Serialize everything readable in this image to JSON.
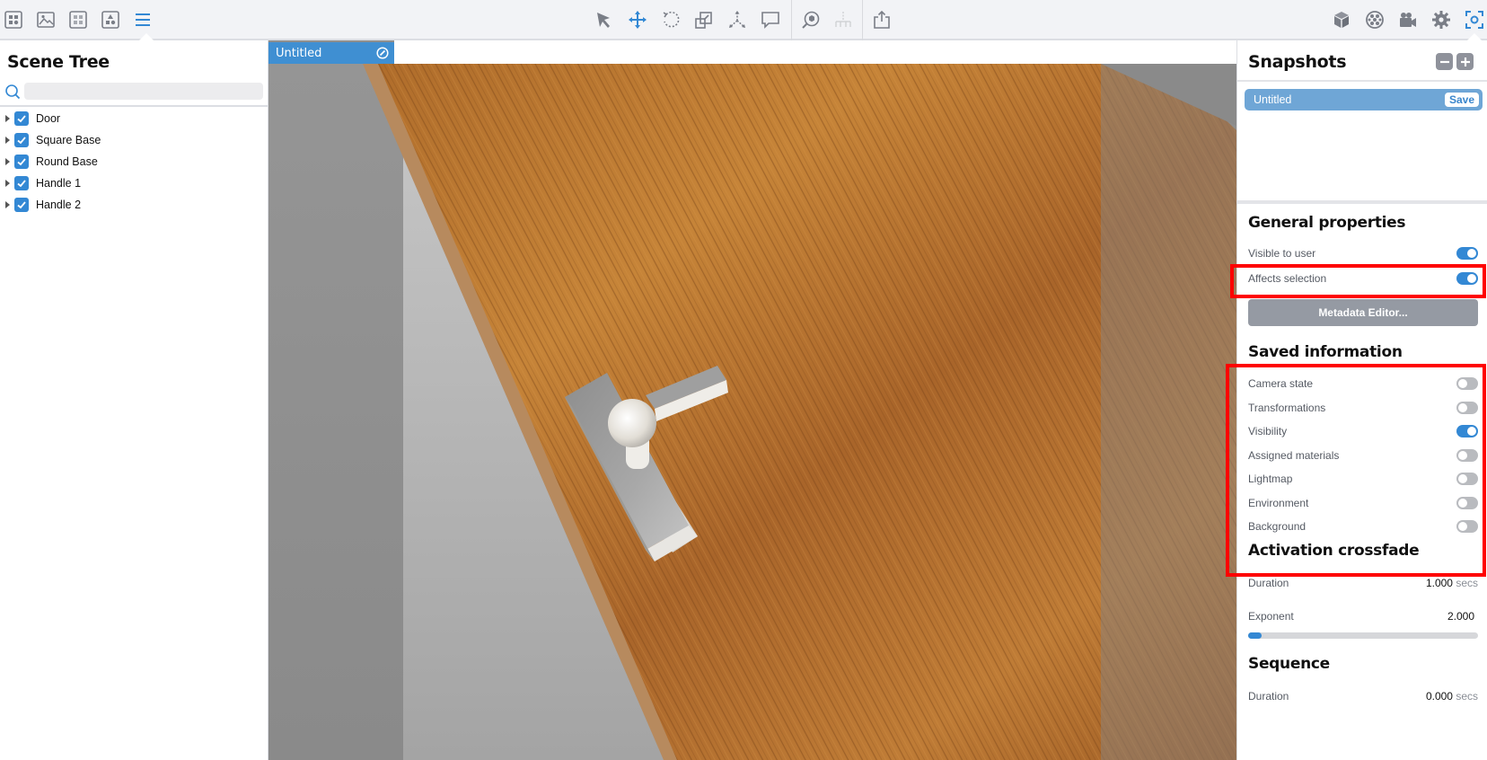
{
  "toolbar": {
    "left_icons": [
      "grid-view-icon",
      "image-icon",
      "pattern-grid-icon",
      "shapes-icon",
      "list-menu-icon"
    ],
    "center_icons": [
      "select-arrow-icon",
      "move-icon",
      "rotate-icon",
      "scale-icon",
      "explode-icon",
      "comment-icon"
    ],
    "extra_icons": [
      "cube-search-icon",
      "hierarchy-icon"
    ],
    "export_icon": "share-export-icon",
    "right_icons": [
      "cube-icon",
      "material-ball-icon",
      "video-camera-icon",
      "gear-icon",
      "focus-frame-icon"
    ],
    "active_left": "list-menu-icon",
    "active_center": "move-icon",
    "active_right": "focus-frame-icon"
  },
  "scene_tree": {
    "title": "Scene Tree",
    "search_placeholder": "",
    "items": [
      {
        "label": "Door",
        "checked": true
      },
      {
        "label": "Square Base",
        "checked": true
      },
      {
        "label": "Round Base",
        "checked": true
      },
      {
        "label": "Handle 1",
        "checked": true
      },
      {
        "label": "Handle 2",
        "checked": true
      }
    ]
  },
  "viewport": {
    "tab_label": "Untitled"
  },
  "snapshots": {
    "title": "Snapshots",
    "items": [
      {
        "label": "Untitled",
        "save_label": "Save"
      }
    ]
  },
  "general_properties": {
    "title": "General properties",
    "visible_to_user": {
      "label": "Visible to user",
      "on": true
    },
    "affects_selection": {
      "label": "Affects selection",
      "on": true
    },
    "metadata_button": "Metadata Editor..."
  },
  "saved_information": {
    "title": "Saved information",
    "items": [
      {
        "label": "Camera state",
        "on": false
      },
      {
        "label": "Transformations",
        "on": false
      },
      {
        "label": "Visibility",
        "on": true
      },
      {
        "label": "Assigned materials",
        "on": false
      },
      {
        "label": "Lightmap",
        "on": false
      },
      {
        "label": "Environment",
        "on": false
      },
      {
        "label": "Background",
        "on": false
      }
    ]
  },
  "activation_crossfade": {
    "title": "Activation crossfade",
    "duration_label": "Duration",
    "duration_value": "1.000",
    "duration_unit": "secs",
    "exponent_label": "Exponent",
    "exponent_value": "2.000",
    "exponent_fraction": 0.06
  },
  "sequence": {
    "title": "Sequence",
    "duration_label": "Duration",
    "duration_value": "0.000",
    "duration_unit": "secs"
  },
  "colors": {
    "accent": "#3388d4",
    "highlight": "#ff0000",
    "toolbar_bg": "#f2f3f6"
  }
}
